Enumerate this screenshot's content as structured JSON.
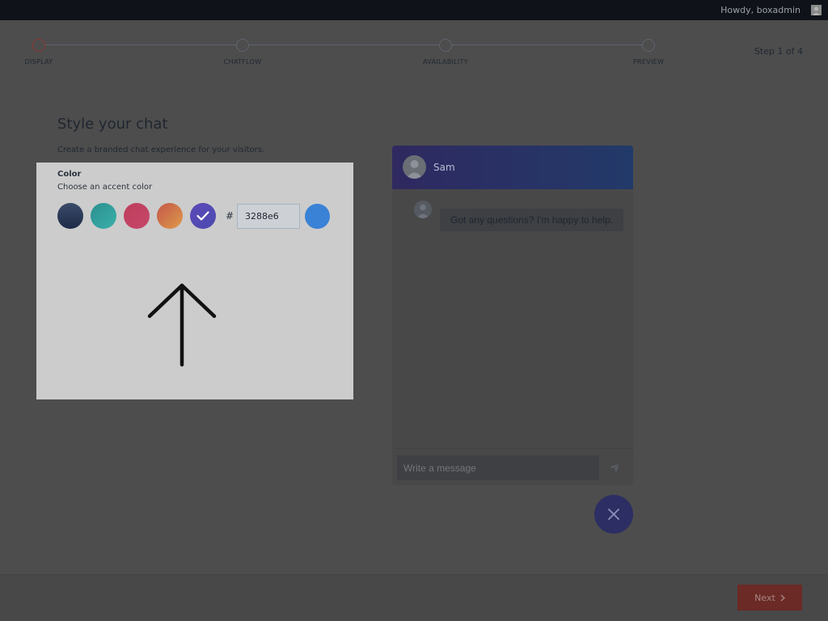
{
  "header": {
    "greeting": "Howdy, boxadmin",
    "avatar_icon": "user-avatar-icon"
  },
  "wizard": {
    "steps": [
      {
        "label": "DISPLAY",
        "active": true
      },
      {
        "label": "CHATFLOW",
        "active": false
      },
      {
        "label": "AVAILABILITY",
        "active": false
      },
      {
        "label": "PREVIEW",
        "active": false
      }
    ],
    "step_count": "Step 1 of 4"
  },
  "main": {
    "title": "Style your chat",
    "subtitle": "Create a branded chat experience for your visitors."
  },
  "color_panel": {
    "title": "Color",
    "subtitle": "Choose an accent color",
    "swatches": [
      {
        "name": "navy",
        "gradient": [
          "#1e2b47",
          "#3a4b6a"
        ],
        "selected": false
      },
      {
        "name": "teal",
        "gradient": [
          "#2a8f8f",
          "#34a2a0"
        ],
        "selected": false
      },
      {
        "name": "pink",
        "gradient": [
          "#a83a52",
          "#bf3d5c"
        ],
        "selected": false
      },
      {
        "name": "orange",
        "gradient": [
          "#b85a3c",
          "#c67e44"
        ],
        "selected": false
      },
      {
        "name": "purple",
        "gradient": [
          "#4b3f9c",
          "#3a3a8f"
        ],
        "selected": true
      }
    ],
    "hash_symbol": "#",
    "hex_value": "3288e6",
    "preview_color": "#2f6ab0"
  },
  "chat_preview": {
    "agent_name": "Sam",
    "message": "Got any questions? I'm happy to help.",
    "input_placeholder": "Write a message",
    "send_icon": "send-icon",
    "close_icon": "close-icon"
  },
  "footer": {
    "next_label": "Next",
    "next_icon": "chevron-right-icon"
  }
}
